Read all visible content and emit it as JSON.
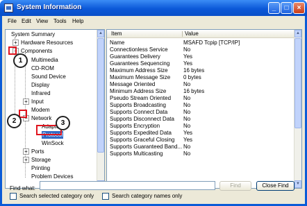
{
  "window": {
    "title": "System Information"
  },
  "menu": [
    "File",
    "Edit",
    "View",
    "Tools",
    "Help"
  ],
  "tree": {
    "items": [
      "System Summary",
      "Hardware Resources",
      "Components",
      "Multimedia",
      "CD-ROM",
      "Sound Device",
      "Display",
      "Infrared",
      "Input",
      "Modem",
      "Network",
      "Adapter",
      "Protocol",
      "WinSock",
      "Ports",
      "Storage",
      "Printing",
      "Problem Devices"
    ]
  },
  "list": {
    "columns": [
      "Item",
      "Value"
    ],
    "rows": [
      [
        "Name",
        "MSAFD Tcpip [TCP/IP]"
      ],
      [
        "Connectionless Service",
        "No"
      ],
      [
        "Guarantees Delivery",
        "Yes"
      ],
      [
        "Guarantees Sequencing",
        "Yes"
      ],
      [
        "Maximum Address Size",
        "16 bytes"
      ],
      [
        "Maximum Message Size",
        "0 bytes"
      ],
      [
        "Message Oriented",
        "No"
      ],
      [
        "Minimum Address Size",
        "16 bytes"
      ],
      [
        "Pseudo Stream Oriented",
        "No"
      ],
      [
        "Supports Broadcasting",
        "No"
      ],
      [
        "Supports Connect Data",
        "No"
      ],
      [
        "Supports Disconnect Data",
        "No"
      ],
      [
        "Supports Encryption",
        "No"
      ],
      [
        "Supports Expedited Data",
        "Yes"
      ],
      [
        "Supports Graceful Closing",
        "Yes"
      ],
      [
        "Supports Guaranteed Band...",
        "No"
      ],
      [
        "Supports Multicasting",
        "No"
      ]
    ]
  },
  "find": {
    "label": "Find what:",
    "value": "",
    "find_button": "Find",
    "close_button": "Close Find",
    "option1": "Search selected category only",
    "option2": "Search category names only"
  },
  "callouts": [
    "1",
    "2",
    "3"
  ],
  "colors": {
    "selection": "#316ac5",
    "callout_outline": "#e0141e",
    "title_bar": "#0a5bd7"
  }
}
